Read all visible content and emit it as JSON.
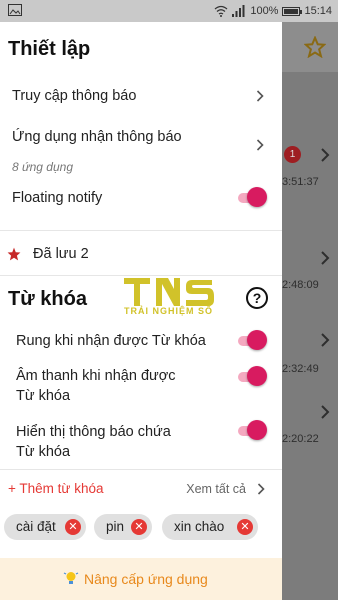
{
  "status_bar": {
    "battery_percent": "100%",
    "time": "15:14",
    "battery_level": 1.0,
    "icons": [
      "image-icon",
      "wifi-icon",
      "signal-icon",
      "battery-icon"
    ]
  },
  "drawer": {
    "title": "Thiết lập",
    "notification_access": "Truy cập thông báo",
    "receiving_apps": "Ứng dụng nhận thông báo",
    "receiving_apps_count": "8 ứng dụng",
    "floating_notify": "Floating notify",
    "floating_notify_on": true,
    "saved": "Đã lưu 2"
  },
  "keywords": {
    "section_title": "Từ khóa",
    "vibrate": "Rung khi nhận được Từ khóa",
    "sound_line1": "Âm thanh khi nhận được",
    "sound_line2": "Từ khóa",
    "show_line1": "Hiển thị thông báo chứa",
    "show_line2": "Từ khóa",
    "add": "+ Thêm từ khóa",
    "see_all": "Xem tất cả",
    "chips": [
      "cài đặt",
      "pin",
      "xin chào"
    ]
  },
  "upgrade": {
    "label": "Nâng cấp ứng dụng"
  },
  "background": {
    "badge": "1",
    "times": [
      "3:51:37",
      "2:48:09",
      "2:32:49",
      "2:20:22"
    ]
  },
  "watermark": {
    "logo_text": "TNS",
    "tagline": "TRẢI NGHIỆM SỐ"
  },
  "colors": {
    "accent": "#d81b60",
    "accent_light": "#f4a9c0",
    "red": "#e53935",
    "star": "#c62828",
    "upgrade_bg": "#fdf1dd",
    "upgrade_text": "#e8891c",
    "watermark": "#d1c22a"
  }
}
